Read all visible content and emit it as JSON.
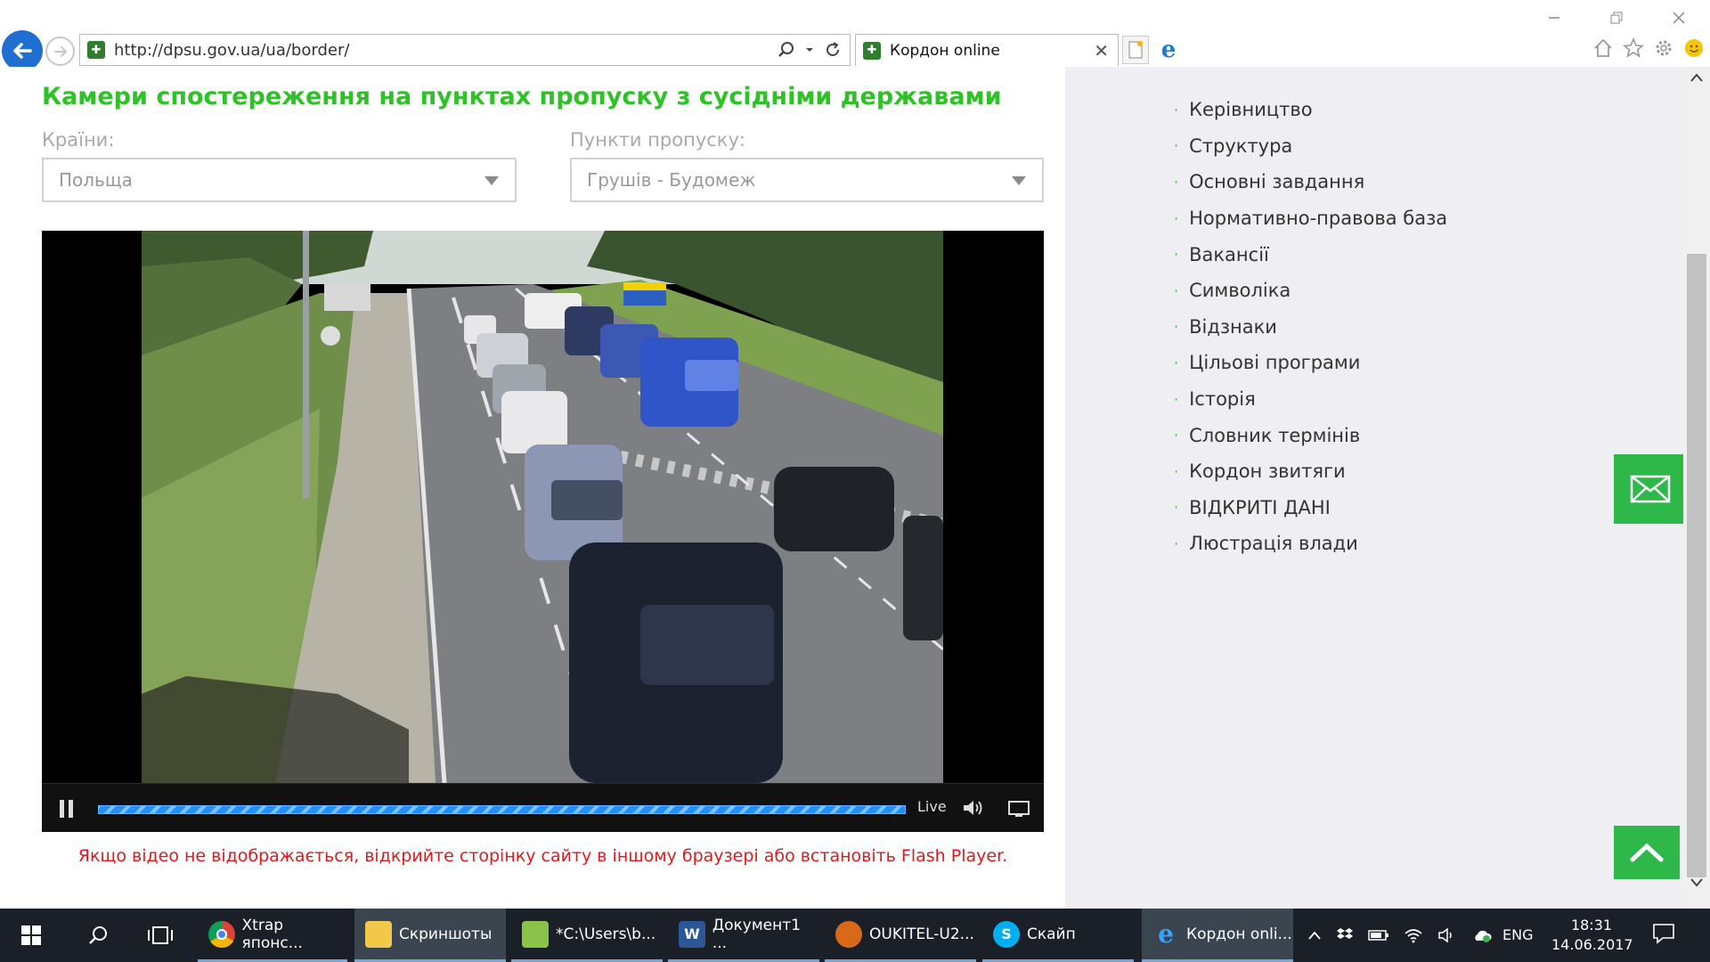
{
  "browser": {
    "url": "http://dpsu.gov.ua/ua/border/",
    "tab_title": "Кордон online",
    "tab_close": "✕",
    "favicon_glyph": "✚"
  },
  "page": {
    "heading": "Камери спостереження на пунктах пропуску з сусідніми державами",
    "countries_label": "Країни:",
    "countries_value": "Польща",
    "checkpoints_label": "Пункти пропуску:",
    "checkpoints_value": "Грушів - Будомеж",
    "live_label": "Live",
    "notice": "Якщо відео не відображається, відкрийте сторінку сайту в іншому браузері або встановіть Flash Player."
  },
  "sidebar": {
    "items": [
      "Керівництво",
      "Структура",
      "Основні завдання",
      "Нормативно-правова база",
      "Вакансії",
      "Символіка",
      "Відзнаки",
      "Цільові програми",
      "Історія",
      "Словник термінів",
      "Кордон звитяги",
      "ВІДКРИТІ ДАНІ",
      "Люстрація влади"
    ],
    "bullet": "·"
  },
  "taskbar": {
    "items": [
      {
        "label": "Xtrap японс...",
        "icon": "chrome-icon"
      },
      {
        "label": "Скриншоты",
        "icon": "folder-icon"
      },
      {
        "label": "*C:\\Users\\b...",
        "icon": "notepad-icon"
      },
      {
        "label": "Документ1 ...",
        "icon": "word-icon"
      },
      {
        "label": "OUKITEL-U2...",
        "icon": "app-icon"
      },
      {
        "label": "Скайп",
        "icon": "skype-icon"
      },
      {
        "label": "Кордон onli...",
        "icon": "ie-icon"
      }
    ],
    "lang": "ENG",
    "time": "18:31",
    "date": "14.06.2017"
  },
  "colors": {
    "accent_green": "#2ec227",
    "button_green": "#2fb84a",
    "notice_red": "#e01a1a",
    "taskbar": "#1b2028"
  }
}
